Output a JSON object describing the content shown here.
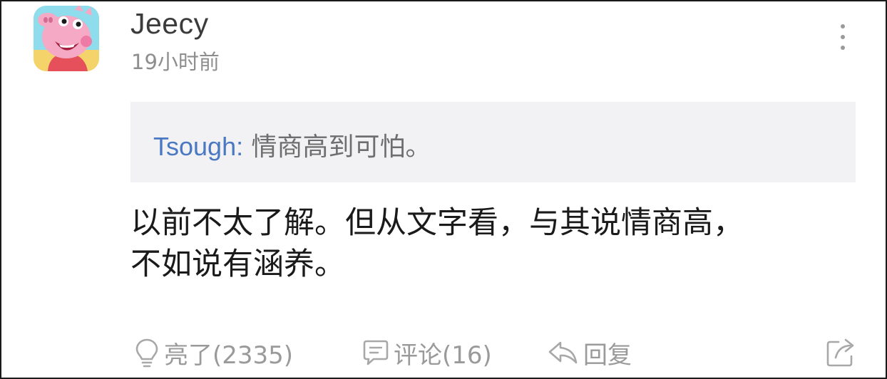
{
  "comment": {
    "author": "Jeecy",
    "time": "19小时前",
    "quote": {
      "author": "Tsough:",
      "text": "情商高到可怕。"
    },
    "body_line1": "以前不太了解。但从文字看，与其说情商高，",
    "body_line2": "不如说有涵养。"
  },
  "actions": {
    "light_label": "亮了(2335)",
    "comment_label": "评论(16)",
    "reply_label": "回复"
  },
  "icons": {
    "avatar": "peppa-pig-avatar",
    "more": "more-vertical-icon",
    "light": "lightbulb-icon",
    "comment": "comment-bubble-icon",
    "reply": "reply-arrow-icon",
    "share": "share-icon"
  },
  "colors": {
    "author_link": "#4a78c2",
    "quote_bg": "#f2f2f4",
    "muted": "#9a9a9a"
  }
}
